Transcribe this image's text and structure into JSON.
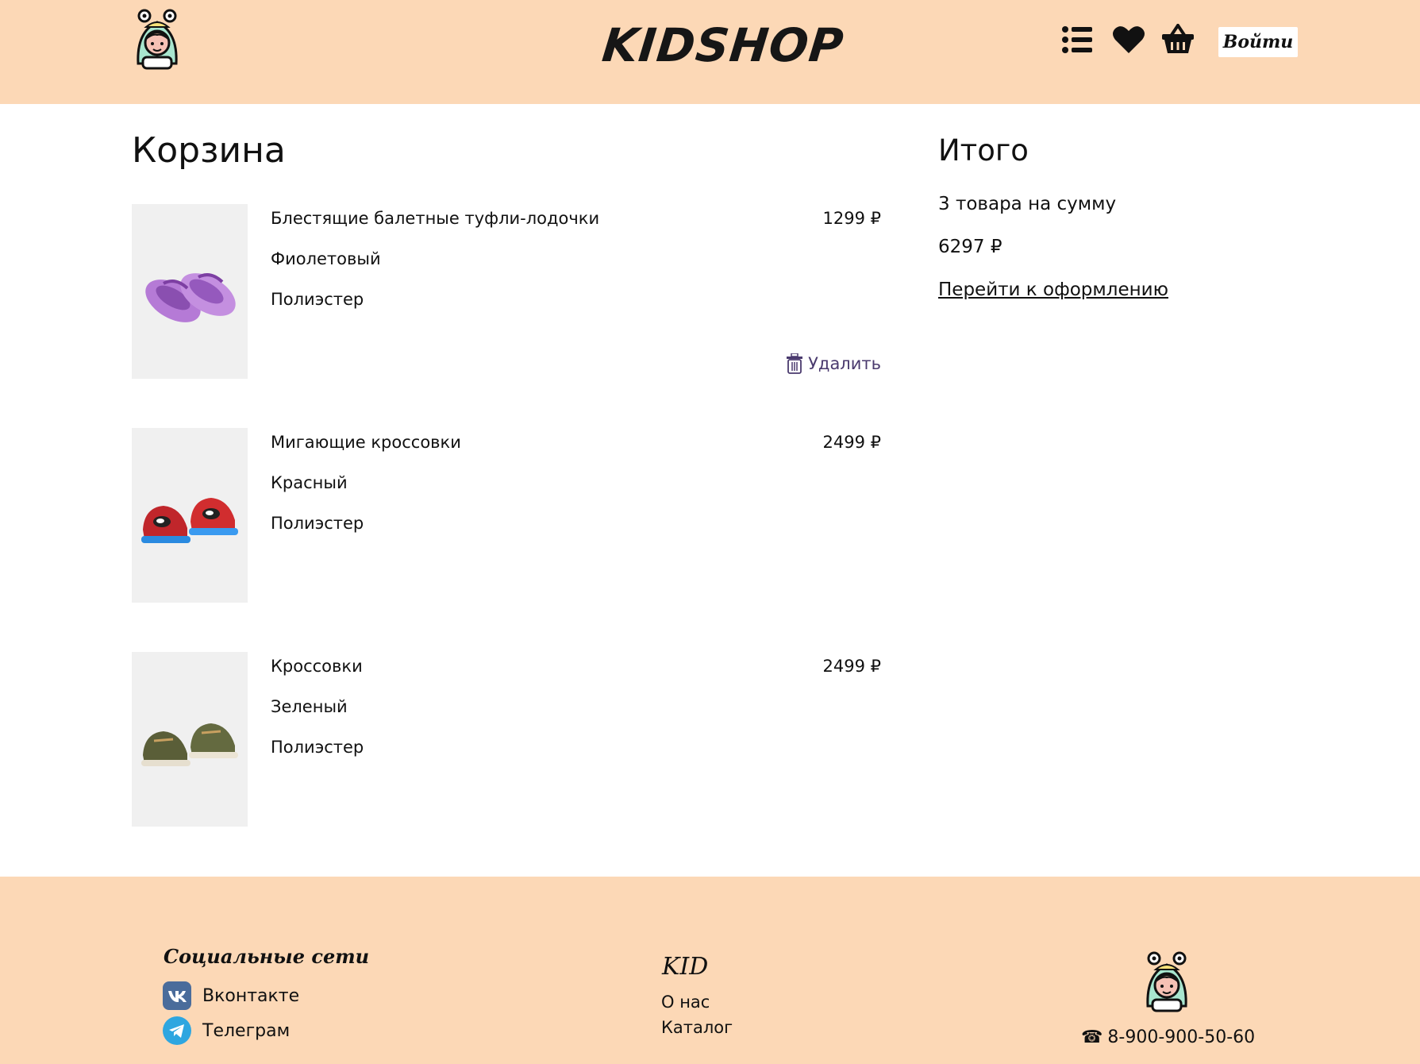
{
  "header": {
    "brand": "KIDSHOP",
    "login_label": "Войти",
    "icons": [
      "list-icon",
      "heart-icon",
      "basket-icon"
    ]
  },
  "cart": {
    "title": "Корзина",
    "delete_label": "Удалить",
    "items": [
      {
        "name": "Блестящие балетные туфли-лодочки",
        "color": "Фиолетовый",
        "material": "Полиэстер",
        "price": "1299 ₽"
      },
      {
        "name": "Мигающие кроссовки",
        "color": "Красный",
        "material": "Полиэстер",
        "price": "2499 ₽"
      },
      {
        "name": "Кроссовки",
        "color": "Зеленый",
        "material": "Полиэстер",
        "price": "2499 ₽"
      }
    ]
  },
  "summary": {
    "title": "Итого",
    "count_text": "3 товара на сумму",
    "total": "6297 ₽",
    "checkout_label": "Перейти к оформлению"
  },
  "footer": {
    "social_title": "Социальные сети",
    "social": [
      {
        "label": "Вконтакте",
        "icon": "vk-icon"
      },
      {
        "label": "Телеграм",
        "icon": "telegram-icon"
      }
    ],
    "brand_short": "KID",
    "links": [
      "О нас",
      "Каталог"
    ],
    "phone": "8-900-900-50-60"
  },
  "colors": {
    "header_bg": "#fcd8b6",
    "footer_bg": "#fcd8b6",
    "delete": "#4a3a6e"
  }
}
